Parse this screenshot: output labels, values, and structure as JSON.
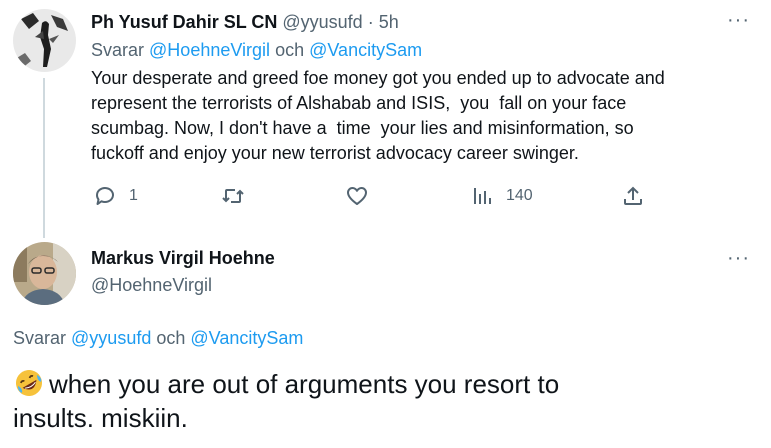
{
  "tweet1": {
    "display_name": "Ph Yusuf Dahir SL CN",
    "handle": "@yyusufd",
    "dot": "·",
    "time": "5h",
    "more": "···",
    "replying_prefix": "Svarar",
    "replying_user1": "@HoehneVirgil",
    "replying_conj": "och",
    "replying_user2": "@VancitySam",
    "text_lines": [
      "Your desperate and greed foe money got you ended up to advocate and",
      "represent the terrorists of Alshabab and ISIS,  you  fall on your face",
      "scumbag. Now, I don't have a  time  your lies and misinformation, so",
      "fuckoff and enjoy your new terrorist advocacy career swinger."
    ],
    "actions": {
      "reply_icon": "reply-bubble-icon",
      "reply_count": "1",
      "retweet_icon": "retweet-icon",
      "like_icon": "heart-icon",
      "views_icon": "views-bars-icon",
      "views_count": "140",
      "share_icon": "share-upload-icon"
    }
  },
  "tweet2": {
    "display_name": "Markus Virgil Hoehne",
    "handle": "@HoehneVirgil",
    "more": "···",
    "replying_prefix": "Svarar",
    "replying_user1": "@yyusufd",
    "replying_conj": "och",
    "replying_user2": "@VancitySam",
    "emoji": "rolling-on-floor-laughing-emoji",
    "text_line1": "when you are out of arguments you resort to",
    "text_line2": "insults. miskiin."
  },
  "colors": {
    "link": "#1d9bf0",
    "secondary_text": "#536471",
    "primary_text": "#0f1419",
    "thread_line": "#cfd9de"
  }
}
